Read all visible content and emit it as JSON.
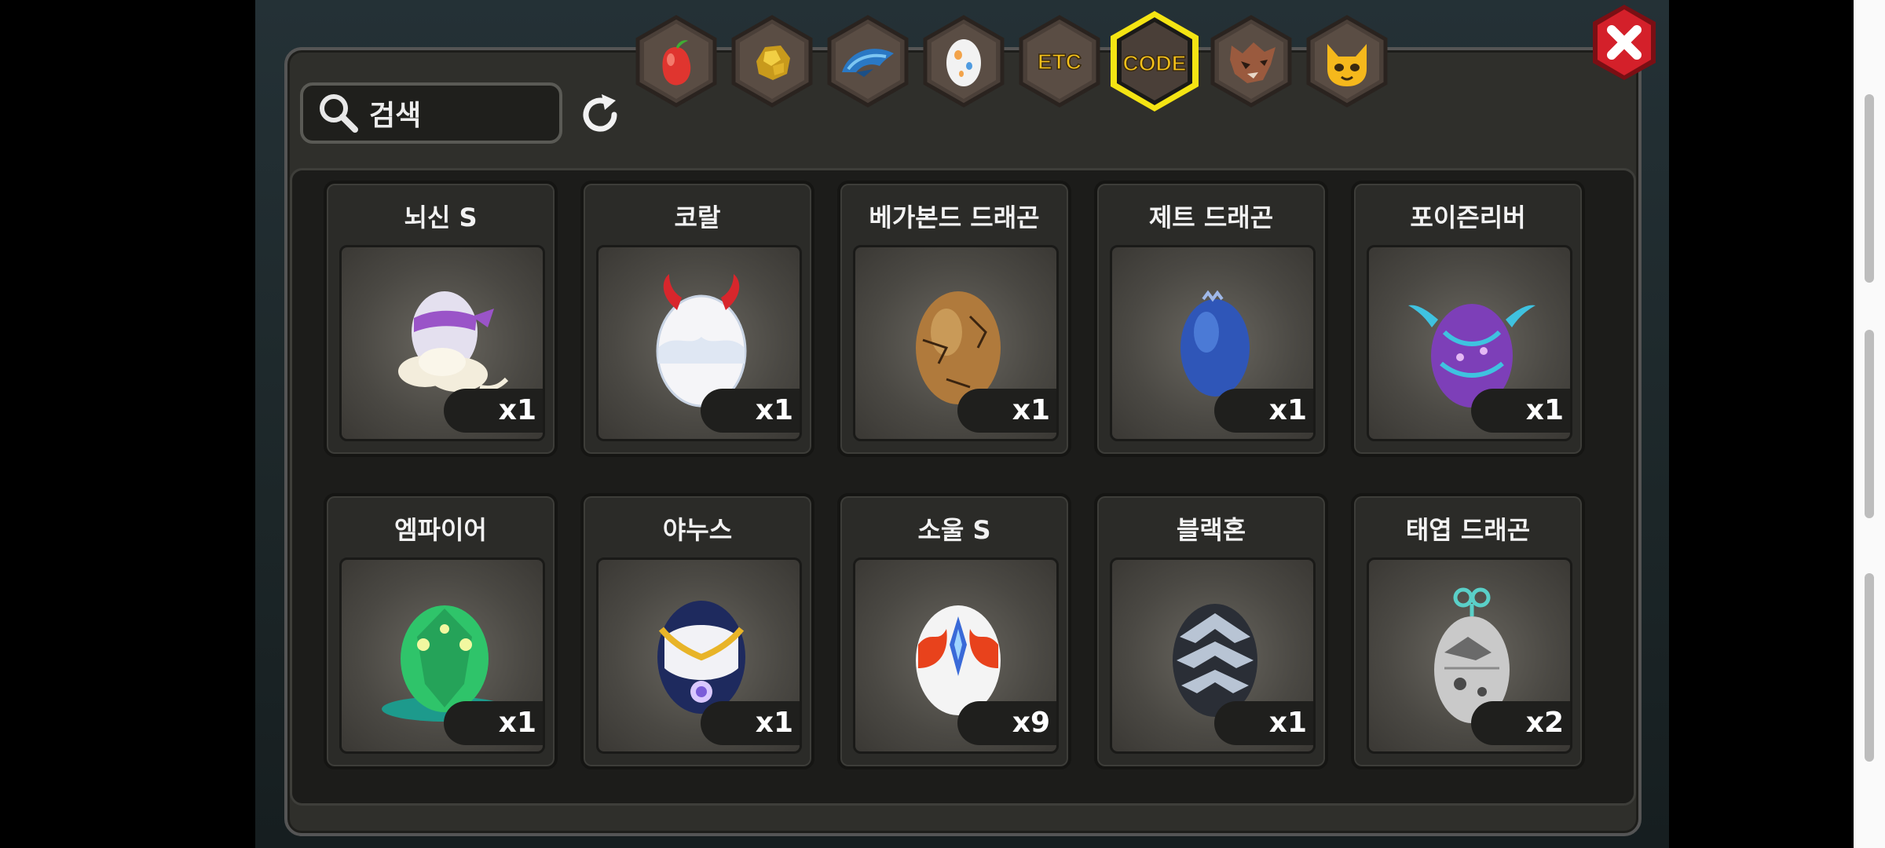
{
  "search": {
    "label": "검색"
  },
  "tabs": [
    {
      "name": "tab-fruit",
      "icon": "fruit-icon"
    },
    {
      "name": "tab-gold",
      "icon": "gold-ore-icon"
    },
    {
      "name": "tab-dragon-scale",
      "icon": "dragon-scale-icon"
    },
    {
      "name": "tab-egg",
      "icon": "egg-icon"
    },
    {
      "name": "tab-etc",
      "label": "ETC"
    },
    {
      "name": "tab-code",
      "label": "CODE",
      "selected": true
    },
    {
      "name": "tab-beast",
      "icon": "wolf-head-icon"
    },
    {
      "name": "tab-pet",
      "icon": "fox-face-icon"
    }
  ],
  "items": [
    {
      "name": "뇌신 S",
      "count": "x1",
      "egg": "egg-purple-cloud-icon"
    },
    {
      "name": "코랄",
      "count": "x1",
      "egg": "egg-white-red-horn-icon"
    },
    {
      "name": "베가본드 드래곤",
      "count": "x1",
      "egg": "egg-brown-cracked-icon"
    },
    {
      "name": "제트 드래곤",
      "count": "x1",
      "egg": "egg-blue-icon"
    },
    {
      "name": "포이즌리버",
      "count": "x1",
      "egg": "egg-purple-striped-icon"
    },
    {
      "name": "엠파이어",
      "count": "x1",
      "egg": "egg-green-crystal-icon"
    },
    {
      "name": "야누스",
      "count": "x1",
      "egg": "egg-navy-gold-icon"
    },
    {
      "name": "소울 S",
      "count": "x9",
      "egg": "egg-white-flame-icon"
    },
    {
      "name": "블랙혼",
      "count": "x1",
      "egg": "egg-black-armored-icon"
    },
    {
      "name": "태엽 드래곤",
      "count": "x2",
      "egg": "egg-windup-icon"
    }
  ],
  "colors": {
    "selected_tab_border": "#f4e413",
    "close_red": "#d4202a",
    "tab_label": "#f6c21a"
  }
}
